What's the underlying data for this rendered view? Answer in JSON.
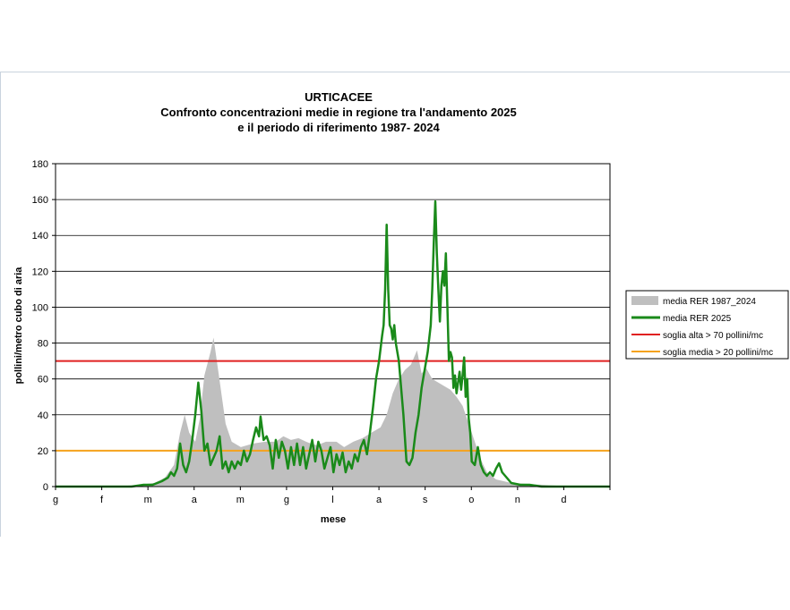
{
  "chart_data": {
    "type": "area+line",
    "title": "URTICACEE",
    "subtitle_lines": [
      "Confronto concentrazioni medie in regione tra l'andamento 2025",
      "e il periodo di riferimento 1987- 2024"
    ],
    "xlabel": "mese",
    "ylabel": "pollini/metro cubo di aria",
    "ylim": [
      0,
      180
    ],
    "yticks": [
      0,
      20,
      40,
      60,
      80,
      100,
      120,
      140,
      160,
      180
    ],
    "months": [
      "g",
      "f",
      "m",
      "a",
      "m",
      "g",
      "l",
      "a",
      "s",
      "o",
      "n",
      "d"
    ],
    "grid": true,
    "legend_position": "right",
    "thresholds": [
      {
        "name": "soglia alta > 70 pollini/mc",
        "value": 70,
        "color": "#e02020"
      },
      {
        "name": "soglia media > 20 pollini/mc",
        "value": 20,
        "color": "#f5a21c"
      }
    ],
    "series": [
      {
        "name": "media RER 1987_2024",
        "kind": "area",
        "color": "#bfbfbf",
        "points": [
          [
            0,
            0
          ],
          [
            20,
            0
          ],
          [
            40,
            0
          ],
          [
            55,
            1
          ],
          [
            65,
            2
          ],
          [
            72,
            5
          ],
          [
            78,
            12
          ],
          [
            82,
            30
          ],
          [
            85,
            40
          ],
          [
            88,
            30
          ],
          [
            92,
            25
          ],
          [
            95,
            38
          ],
          [
            98,
            62
          ],
          [
            102,
            75
          ],
          [
            104,
            83
          ],
          [
            107,
            65
          ],
          [
            112,
            35
          ],
          [
            116,
            25
          ],
          [
            122,
            22
          ],
          [
            130,
            24
          ],
          [
            138,
            25
          ],
          [
            145,
            25
          ],
          [
            150,
            28
          ],
          [
            155,
            26
          ],
          [
            160,
            27
          ],
          [
            165,
            25
          ],
          [
            168,
            24
          ],
          [
            172,
            23
          ],
          [
            178,
            25
          ],
          [
            185,
            25
          ],
          [
            190,
            22
          ],
          [
            196,
            25
          ],
          [
            202,
            27
          ],
          [
            208,
            30
          ],
          [
            214,
            33
          ],
          [
            218,
            40
          ],
          [
            222,
            52
          ],
          [
            226,
            60
          ],
          [
            230,
            65
          ],
          [
            234,
            68
          ],
          [
            238,
            76
          ],
          [
            241,
            63
          ],
          [
            244,
            66
          ],
          [
            248,
            60
          ],
          [
            252,
            58
          ],
          [
            256,
            56
          ],
          [
            260,
            54
          ],
          [
            264,
            50
          ],
          [
            268,
            45
          ],
          [
            272,
            35
          ],
          [
            276,
            25
          ],
          [
            280,
            15
          ],
          [
            284,
            8
          ],
          [
            290,
            4
          ],
          [
            300,
            2
          ],
          [
            320,
            1
          ],
          [
            340,
            0
          ],
          [
            365,
            0
          ]
        ]
      },
      {
        "name": "media RER 2025",
        "kind": "line",
        "color": "#1a8a1a",
        "points": [
          [
            0,
            0
          ],
          [
            10,
            0
          ],
          [
            20,
            0
          ],
          [
            30,
            0
          ],
          [
            40,
            0
          ],
          [
            50,
            0
          ],
          [
            58,
            1
          ],
          [
            64,
            1
          ],
          [
            70,
            3
          ],
          [
            74,
            5
          ],
          [
            76,
            8
          ],
          [
            78,
            6
          ],
          [
            80,
            10
          ],
          [
            82,
            24
          ],
          [
            84,
            12
          ],
          [
            86,
            8
          ],
          [
            88,
            14
          ],
          [
            90,
            26
          ],
          [
            92,
            40
          ],
          [
            94,
            58
          ],
          [
            96,
            42
          ],
          [
            98,
            20
          ],
          [
            100,
            24
          ],
          [
            102,
            12
          ],
          [
            104,
            16
          ],
          [
            106,
            20
          ],
          [
            108,
            28
          ],
          [
            110,
            10
          ],
          [
            112,
            14
          ],
          [
            114,
            8
          ],
          [
            116,
            14
          ],
          [
            118,
            10
          ],
          [
            120,
            14
          ],
          [
            122,
            12
          ],
          [
            124,
            20
          ],
          [
            126,
            14
          ],
          [
            128,
            18
          ],
          [
            130,
            26
          ],
          [
            132,
            33
          ],
          [
            134,
            28
          ],
          [
            135,
            39
          ],
          [
            137,
            26
          ],
          [
            139,
            28
          ],
          [
            141,
            23
          ],
          [
            143,
            10
          ],
          [
            145,
            26
          ],
          [
            147,
            16
          ],
          [
            149,
            25
          ],
          [
            151,
            20
          ],
          [
            153,
            10
          ],
          [
            155,
            22
          ],
          [
            157,
            12
          ],
          [
            159,
            24
          ],
          [
            161,
            12
          ],
          [
            163,
            22
          ],
          [
            165,
            10
          ],
          [
            167,
            18
          ],
          [
            169,
            26
          ],
          [
            171,
            14
          ],
          [
            173,
            25
          ],
          [
            175,
            20
          ],
          [
            177,
            10
          ],
          [
            179,
            16
          ],
          [
            181,
            22
          ],
          [
            183,
            8
          ],
          [
            185,
            18
          ],
          [
            187,
            12
          ],
          [
            189,
            19
          ],
          [
            191,
            8
          ],
          [
            193,
            14
          ],
          [
            195,
            10
          ],
          [
            197,
            18
          ],
          [
            199,
            14
          ],
          [
            201,
            22
          ],
          [
            203,
            26
          ],
          [
            205,
            18
          ],
          [
            207,
            30
          ],
          [
            209,
            44
          ],
          [
            211,
            60
          ],
          [
            213,
            70
          ],
          [
            215,
            84
          ],
          [
            216,
            90
          ],
          [
            217,
            110
          ],
          [
            218,
            146
          ],
          [
            219,
            110
          ],
          [
            220,
            90
          ],
          [
            221,
            88
          ],
          [
            222,
            82
          ],
          [
            223,
            90
          ],
          [
            224,
            80
          ],
          [
            226,
            70
          ],
          [
            227,
            60
          ],
          [
            229,
            40
          ],
          [
            231,
            14
          ],
          [
            233,
            12
          ],
          [
            235,
            16
          ],
          [
            237,
            30
          ],
          [
            239,
            40
          ],
          [
            241,
            55
          ],
          [
            243,
            65
          ],
          [
            245,
            75
          ],
          [
            247,
            90
          ],
          [
            248,
            110
          ],
          [
            249,
            136
          ],
          [
            250,
            159
          ],
          [
            251,
            130
          ],
          [
            252,
            110
          ],
          [
            253,
            92
          ],
          [
            254,
            112
          ],
          [
            255,
            120
          ],
          [
            256,
            112
          ],
          [
            257,
            130
          ],
          [
            258,
            100
          ],
          [
            259,
            70
          ],
          [
            260,
            75
          ],
          [
            261,
            72
          ],
          [
            262,
            55
          ],
          [
            263,
            62
          ],
          [
            264,
            52
          ],
          [
            265,
            58
          ],
          [
            266,
            64
          ],
          [
            267,
            54
          ],
          [
            268,
            62
          ],
          [
            269,
            72
          ],
          [
            270,
            50
          ],
          [
            271,
            60
          ],
          [
            272,
            38
          ],
          [
            273,
            30
          ],
          [
            274,
            14
          ],
          [
            276,
            12
          ],
          [
            278,
            22
          ],
          [
            280,
            12
          ],
          [
            282,
            8
          ],
          [
            284,
            6
          ],
          [
            286,
            8
          ],
          [
            288,
            6
          ],
          [
            290,
            10
          ],
          [
            292,
            13
          ],
          [
            294,
            8
          ],
          [
            296,
            6
          ],
          [
            300,
            2
          ],
          [
            306,
            1
          ],
          [
            312,
            1
          ],
          [
            320,
            0
          ],
          [
            330,
            0
          ],
          [
            340,
            0
          ],
          [
            350,
            0
          ],
          [
            365,
            0
          ]
        ]
      }
    ]
  }
}
